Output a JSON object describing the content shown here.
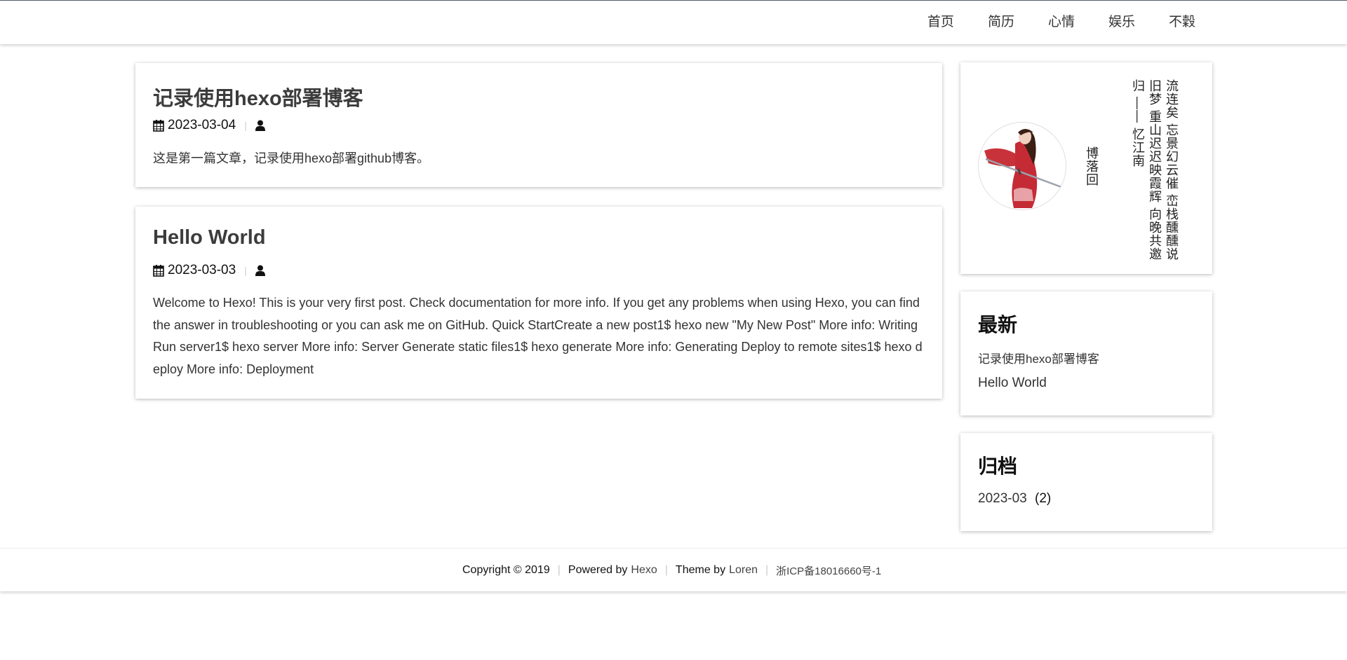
{
  "nav": {
    "items": [
      "首页",
      "简历",
      "心情",
      "娱乐",
      "不穀"
    ]
  },
  "posts": [
    {
      "title": "记录使用hexo部署博客",
      "date": "2023-03-04",
      "excerpt": "这是第一篇文章，记录使用hexo部署github博客。"
    },
    {
      "title": "Hello World",
      "date": "2023-03-03",
      "excerpt": "Welcome to Hexo! This is your very first post. Check documentation for more info. If you get any problems when using Hexo, you can find the answer in troubleshooting or you can ask me on GitHub. Quick StartCreate a new post1$ hexo new \"My New Post\" More info: Writing Run server1$ hexo server More info: Server Generate static files1$ hexo generate More info: Generating Deploy to remote sites1$ hexo deploy More info: Deployment"
    }
  ],
  "profile": {
    "poem": [
      "流连矣 忘景幻云催 峦栈醺醺说",
      "旧梦 重山迟迟映霞辉 向晚共邀",
      "归 —— 忆江南"
    ],
    "blog_name": "博落回"
  },
  "latest": {
    "heading": "最新",
    "items": [
      "记录使用hexo部署博客",
      "Hello World"
    ]
  },
  "archive": {
    "heading": "归档",
    "month": "2023-03",
    "count": "(2)"
  },
  "footer": {
    "copyright": "Copyright © 2019",
    "powered_prefix": "Powered by",
    "powered_link": "Hexo",
    "theme_prefix": "Theme by",
    "theme_link": "Loren",
    "icp": "浙ICP备18016660号-1"
  },
  "colors": {
    "accent": "#4a5a6a",
    "text": "#333333",
    "separator": "#cccccc"
  }
}
